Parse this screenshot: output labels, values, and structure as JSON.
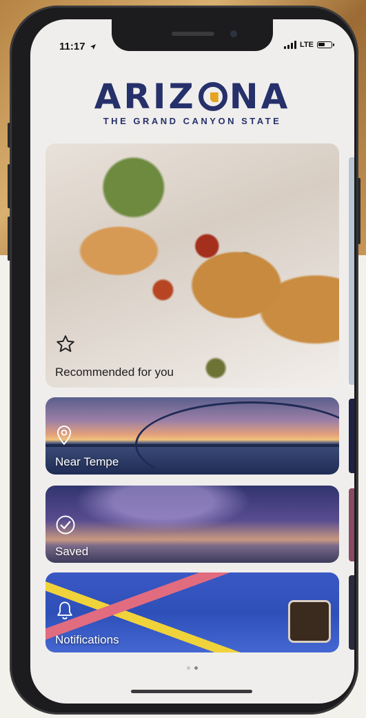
{
  "status_bar": {
    "time": "11:17",
    "network": "LTE"
  },
  "brand": {
    "title_left": "ARIZ",
    "title_right": "NA",
    "subtitle": "THE GRAND CANYON STATE",
    "colors": {
      "navy": "#26306a",
      "gold": "#e6a321"
    }
  },
  "cards": [
    {
      "label": "Recommended for you",
      "icon": "star-icon"
    },
    {
      "label": "Near Tempe",
      "icon": "location-pin-icon"
    },
    {
      "label": "Saved",
      "icon": "check-circle-icon"
    },
    {
      "label": "Notifications",
      "icon": "bell-icon"
    }
  ]
}
